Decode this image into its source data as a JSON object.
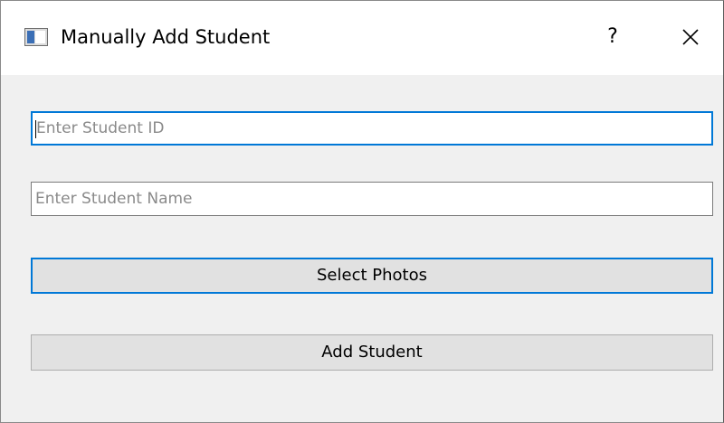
{
  "window": {
    "title": "Manually Add Student",
    "help_label": "?",
    "icons": {
      "app": "window-app-icon",
      "close": "close-icon"
    }
  },
  "form": {
    "student_id": {
      "value": "",
      "placeholder": "Enter Student ID"
    },
    "student_name": {
      "value": "",
      "placeholder": "Enter Student Name"
    },
    "select_photos_label": "Select Photos",
    "add_student_label": "Add Student"
  },
  "colors": {
    "focus_accent": "#0078d7",
    "dialog_background": "#f0f0f0",
    "button_face": "#e1e1e1"
  }
}
